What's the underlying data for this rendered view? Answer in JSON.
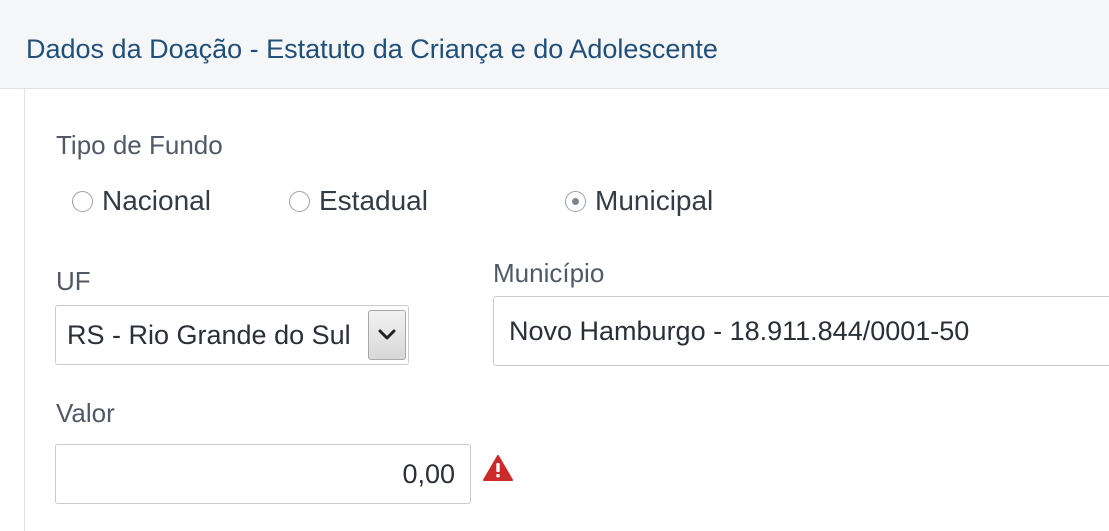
{
  "panel": {
    "title": "Dados da Doação - Estatuto da Criança e do Adolescente"
  },
  "tipo_fundo": {
    "label": "Tipo de Fundo",
    "options": [
      {
        "label": "Nacional",
        "checked": false
      },
      {
        "label": "Estadual",
        "checked": false
      },
      {
        "label": "Municipal",
        "checked": true
      }
    ]
  },
  "uf": {
    "label": "UF",
    "value": "RS - Rio Grande do Sul",
    "arrow_icon": "chevron-down-icon"
  },
  "municipio": {
    "label": "Município",
    "value": "Novo Hamburgo - 18.911.844/0001-50"
  },
  "valor": {
    "label": "Valor",
    "value": "0,00",
    "status_icon": "warning-icon",
    "status_color": "#cc2a2a"
  }
}
